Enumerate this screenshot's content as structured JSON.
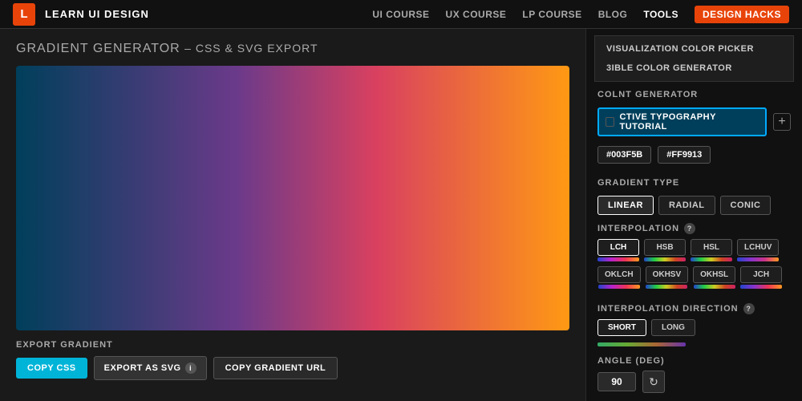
{
  "header": {
    "logo": "L",
    "site_title": "LEARN UI DESIGN",
    "nav": [
      {
        "label": "UI COURSE",
        "id": "ui-course"
      },
      {
        "label": "UX COURSE",
        "id": "ux-course"
      },
      {
        "label": "LP COURSE",
        "id": "lp-course"
      },
      {
        "label": "BLOG",
        "id": "blog"
      },
      {
        "label": "TOOLS",
        "id": "tools",
        "active": true
      },
      {
        "label": "DESIGN HACKS",
        "id": "design-hacks",
        "highlighted": true
      }
    ]
  },
  "page": {
    "title": "GRADIENT GENERATOR",
    "subtitle": "– CSS & SVG EXPORT"
  },
  "dropdown_menu": {
    "items": [
      "VISUALIZATION COLOR PICKER",
      "3IBLE COLOR GENERATOR"
    ]
  },
  "controls": {
    "colnt_generator_label": "COLNT GENERATOR",
    "color_picker_placeholder": "CTIVE TYPOGRAPHY TUTORIAL",
    "color_stops": [
      "#003F5B",
      "#FF9913"
    ],
    "gradient_type": {
      "label": "GRADIENT TYPE",
      "options": [
        "LINEAR",
        "RADIAL",
        "CONIC"
      ],
      "selected": "LINEAR"
    },
    "interpolation": {
      "label": "INTERPOLATION",
      "options": [
        {
          "name": "LCH",
          "selected": true,
          "bar_colors": [
            "#2244cc",
            "#bb22cc",
            "#ee3355",
            "#ff9922"
          ]
        },
        {
          "name": "HSB",
          "selected": false,
          "bar_colors": [
            "#2244cc",
            "#22cc88",
            "#cccc22",
            "#cc2222"
          ]
        },
        {
          "name": "HSL",
          "selected": false,
          "bar_colors": [
            "#2244cc",
            "#22cc88",
            "#cccc22",
            "#cc2222"
          ]
        },
        {
          "name": "LCHUV",
          "selected": false,
          "bar_colors": [
            "#2244cc",
            "#8833cc",
            "#cc3388",
            "#ff9922"
          ]
        },
        {
          "name": "OKLCH",
          "selected": false,
          "bar_colors": [
            "#2244cc",
            "#bb22cc",
            "#ee3355",
            "#ff9922"
          ]
        },
        {
          "name": "OKHSV",
          "selected": false,
          "bar_colors": [
            "#2244cc",
            "#22cc88",
            "#cccc22",
            "#cc2222"
          ]
        },
        {
          "name": "OKHSL",
          "selected": false,
          "bar_colors": [
            "#2244cc",
            "#22cc88",
            "#cccc22",
            "#cc2222"
          ]
        },
        {
          "name": "JCH",
          "selected": false,
          "bar_colors": [
            "#2244cc",
            "#8833cc",
            "#ee3355",
            "#ff9922"
          ]
        }
      ]
    },
    "interpolation_direction": {
      "label": "INTERPOLATION DIRECTION",
      "options": [
        "SHORT",
        "LONG"
      ],
      "selected": "SHORT"
    },
    "angle": {
      "label": "ANGLE (DEG)",
      "value": "90"
    }
  },
  "export": {
    "label": "EXPORT GRADIENT",
    "copy_css": "COPY CSS",
    "export_svg": "EXPORT AS SVG",
    "copy_url": "COPY GRADIENT URL"
  }
}
